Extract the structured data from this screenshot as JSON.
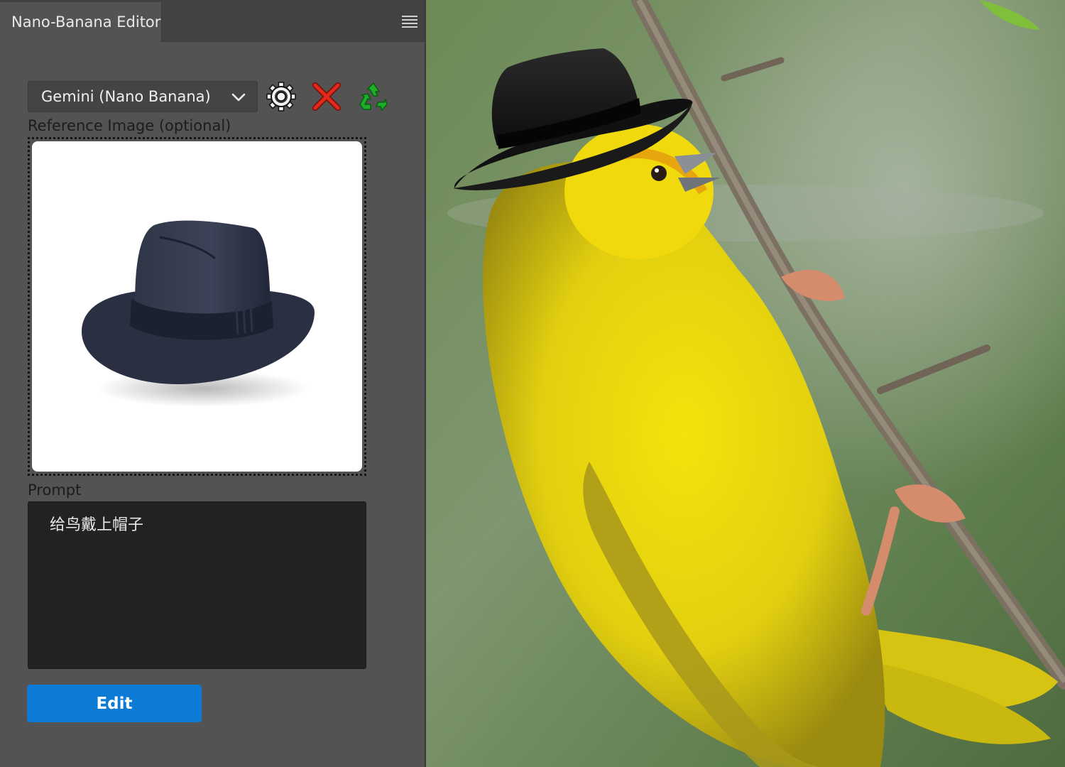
{
  "panel": {
    "tab_title": "Nano-Banana Editor",
    "menu_icon": "hamburger-menu-icon",
    "model_select": {
      "selected": "Gemini (Nano Banana)"
    },
    "toolbar_icons": [
      "gear-icon",
      "close-icon",
      "recycle-icon"
    ],
    "reference_label": "Reference Image (optional)",
    "prompt_label": "Prompt",
    "prompt_value": "给鸟戴上帽子",
    "edit_label": "Edit"
  },
  "colors": {
    "panel_bg": "#535353",
    "accent": "#0d7ad6",
    "prompt_bg": "#222222",
    "close_red": "#e02a1b",
    "recycle_green": "#1fae2a"
  }
}
